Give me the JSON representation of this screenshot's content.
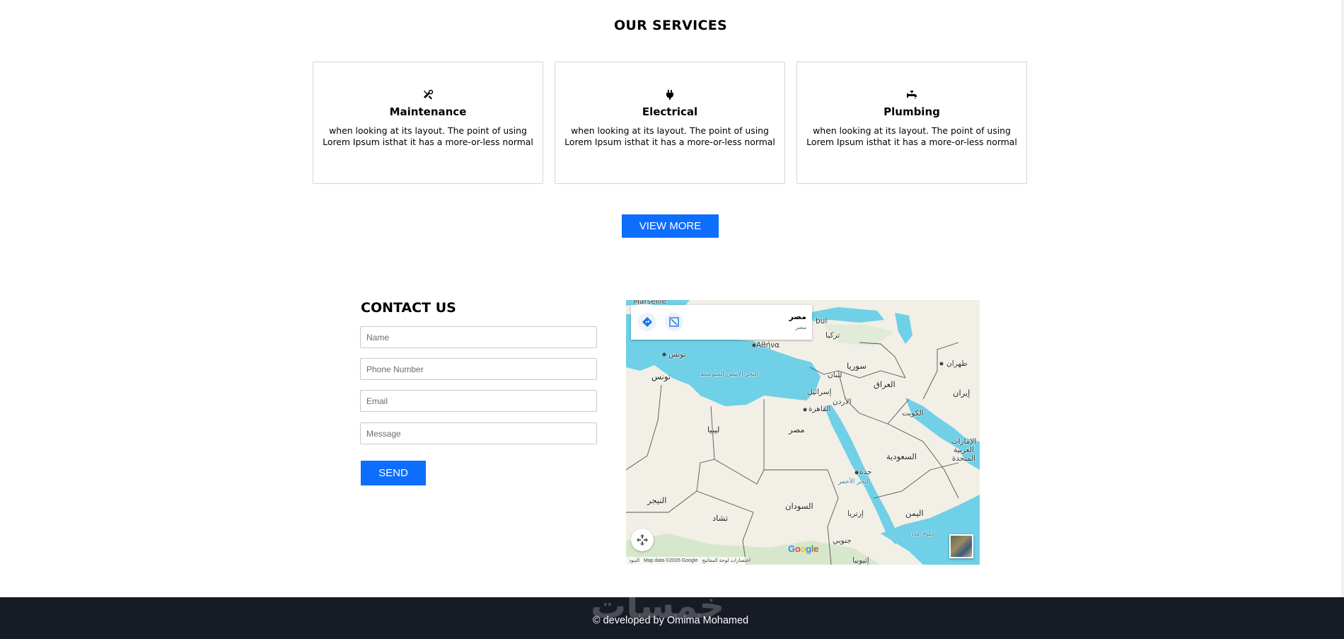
{
  "services": {
    "title": "OUR SERVICES",
    "cards": [
      {
        "icon": "tools-icon",
        "title": "Maintenance",
        "text": "when looking at its layout. The point of using Lorem Ipsum isthat it has a more-or-less normal"
      },
      {
        "icon": "plug-icon",
        "title": "Electrical",
        "text": "when looking at its layout. The point of using Lorem Ipsum isthat it has a more-or-less normal"
      },
      {
        "icon": "faucet-icon",
        "title": "Plumbing",
        "text": "when looking at its layout. The point of using Lorem Ipsum isthat it has a more-or-less normal"
      }
    ],
    "view_more_label": "VIEW MORE"
  },
  "contact": {
    "title": "CONTACT US",
    "fields": {
      "name": {
        "placeholder": "Name",
        "value": ""
      },
      "phone": {
        "placeholder": "Phone Number",
        "value": ""
      },
      "email": {
        "placeholder": "Email",
        "value": ""
      },
      "message": {
        "placeholder": "Message",
        "value": ""
      }
    },
    "send_label": "SEND"
  },
  "map": {
    "place_name": "مصر",
    "place_sub": "مصر",
    "labels": {
      "marseille": "Marseille",
      "istanbul": "bul",
      "athens": "Αθήνα",
      "turkey": "تركيا",
      "tunis_city": "تونس",
      "tunisia": "تونس",
      "med_sea": "البحر الأبيض المتوسط",
      "syria": "سوريا",
      "lebanon": "لبنان",
      "iraq": "العراق",
      "israel": "إسرائيل",
      "jordan": "الأردن",
      "cairo": "القاهرة",
      "libya": "ليبيا",
      "egypt": "مصر",
      "kuwait": "الكويت",
      "iran": "إيران",
      "tehran": "طهران",
      "uae": "الإمارات العربية المتحدة",
      "saudi": "السعودية",
      "jeddah": "جدة",
      "red_sea": "البحر الأحمر",
      "niger": "النيجر",
      "chad": "تشاد",
      "sudan": "السودان",
      "eritrea": "إرتريا",
      "yemen": "اليمن",
      "gulf_aden": "خليج عدن",
      "south_sudan": "جنوبي",
      "ethiopia": "إثيوبيا"
    },
    "google_letters": [
      "G",
      "o",
      "o",
      "g",
      "l",
      "e"
    ],
    "google_colors": [
      "#4285f4",
      "#ea4335",
      "#fbbc05",
      "#4285f4",
      "#34a853",
      "#ea4335"
    ],
    "attribution": "Map data ©2026 Google",
    "shortcuts": "اختصارات لوحة المفاتيح",
    "terms": "البنود"
  },
  "footer": {
    "watermark": "خمسات",
    "credit": "© developed by Omima Mohamed"
  },
  "colors": {
    "accent": "#0d6efd",
    "footer_bg": "#161b26",
    "water": "#6fd0e7"
  }
}
